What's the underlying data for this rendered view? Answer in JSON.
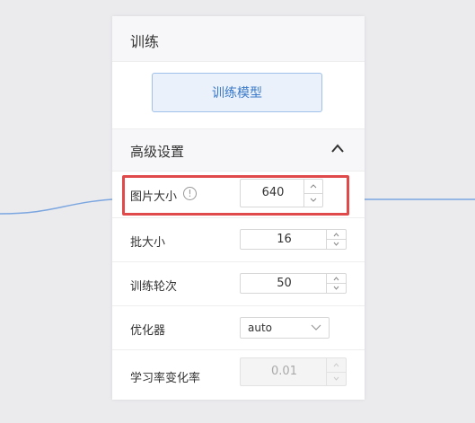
{
  "panel": {
    "title": "训练",
    "train_button": "训练模型",
    "advanced": {
      "title": "高级设置",
      "collapse_icon": "chevron-up-icon",
      "fields": {
        "image_size": {
          "label": "图片大小",
          "value": "640",
          "info_icon": "info-icon"
        },
        "batch_size": {
          "label": "批大小",
          "value": "16"
        },
        "epochs": {
          "label": "训练轮次",
          "value": "50"
        },
        "optimizer": {
          "label": "优化器",
          "value": "auto"
        },
        "lr_change": {
          "label": "学习率变化率",
          "value": "0.01",
          "disabled": true
        }
      }
    }
  },
  "colors": {
    "accent": "#3a79c9",
    "highlight": "#e04a4a",
    "background": "#ebebee",
    "connector_line": "#7ba6e0"
  }
}
